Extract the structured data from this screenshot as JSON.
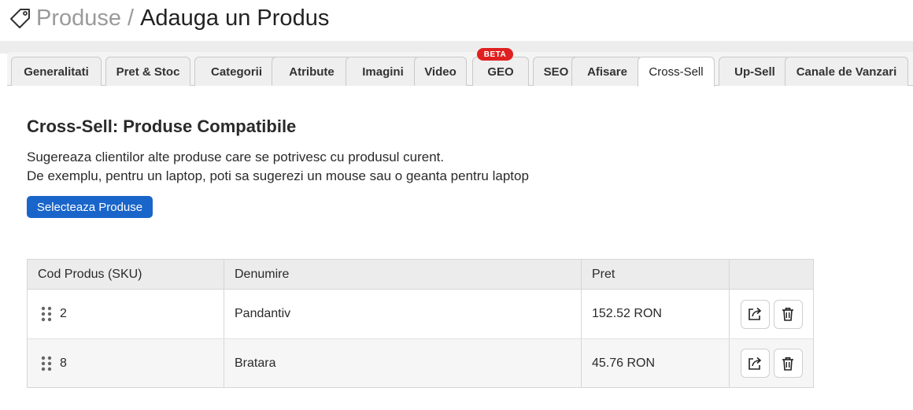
{
  "header": {
    "section": "Produse",
    "separator": "/",
    "page": "Adauga un Produs",
    "icon": "tag-icon"
  },
  "tabs": [
    {
      "label": "Generalitati"
    },
    {
      "label": "Pret & Stoc"
    },
    {
      "label": "Categorii"
    },
    {
      "label": "Atribute"
    },
    {
      "label": "Imagini"
    },
    {
      "label": "Video"
    },
    {
      "label": "GEO",
      "badge": "BETA"
    },
    {
      "label": "SEO"
    },
    {
      "label": "Afisare"
    },
    {
      "label": "Cross-Sell",
      "active": true
    },
    {
      "label": "Up-Sell"
    },
    {
      "label": "Canale de Vanzari"
    }
  ],
  "content": {
    "title": "Cross-Sell: Produse Compatibile",
    "description_line1": "Sugereaza clientilor alte produse care se potrivesc cu produsul curent.",
    "description_line2": "De exemplu, pentru un laptop, poti sa sugerezi un mouse sau o geanta pentru laptop",
    "select_button": "Selecteaza Produse"
  },
  "table": {
    "columns": [
      "Cod Produs (SKU)",
      "Denumire",
      "Pret",
      ""
    ],
    "rows": [
      {
        "sku": "2",
        "name": "Pandantiv",
        "price": "152.52 RON"
      },
      {
        "sku": "8",
        "name": "Bratara",
        "price": "45.76 RON"
      }
    ]
  },
  "colors": {
    "accent": "#1a65c9",
    "badge": "#e02020"
  }
}
